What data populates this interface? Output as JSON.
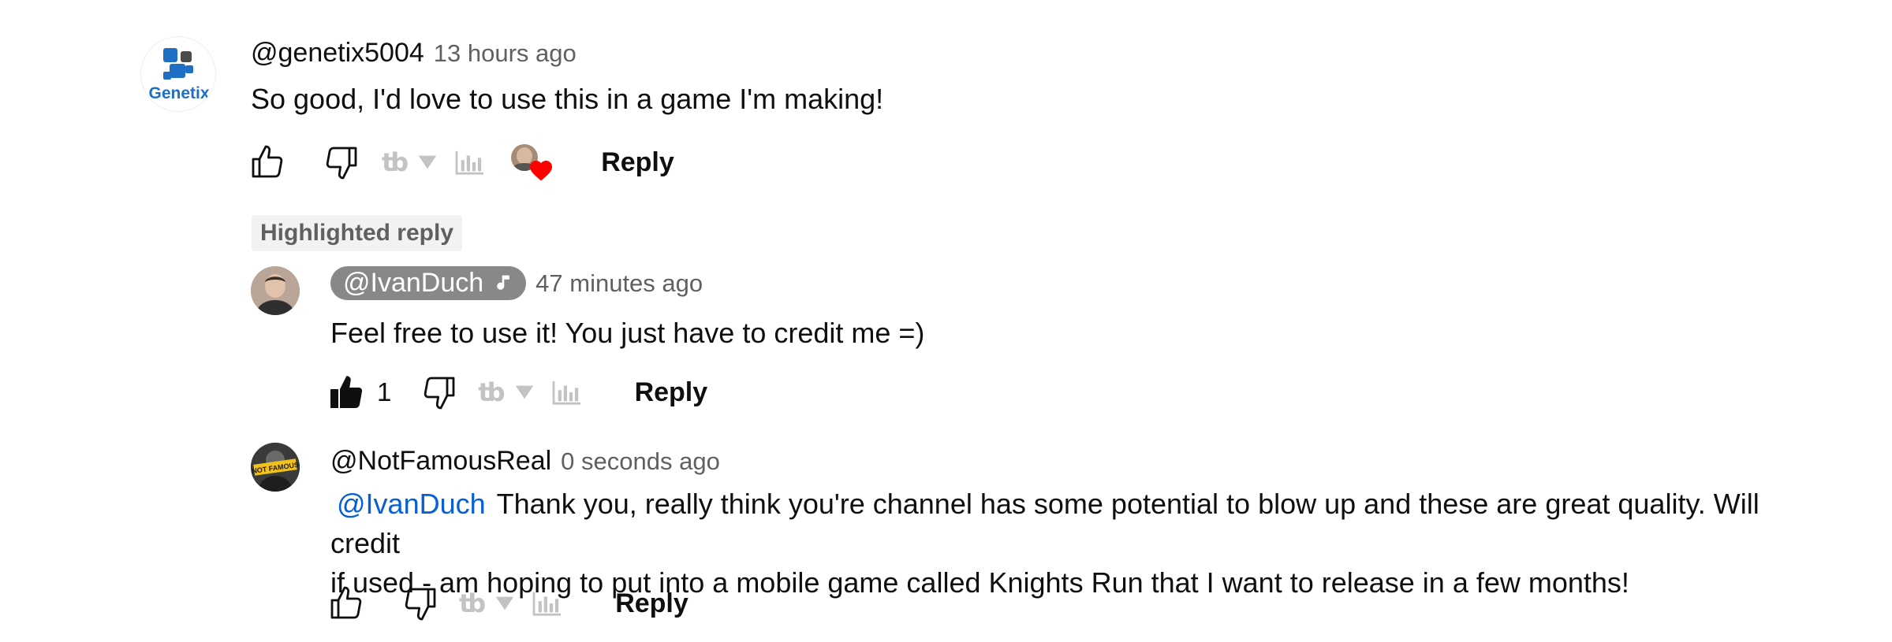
{
  "highlight_label": "Highlighted reply",
  "comments": [
    {
      "author": "@genetix5004",
      "time": "13 hours ago",
      "text": "So good, I'd love to use this in a game I'm making!",
      "avatar_label": "Genetix",
      "like_count": "",
      "reply_label": "Reply",
      "creator_heart": true
    },
    {
      "author": "@IvanDuch",
      "time": "47 minutes ago",
      "text": "Feel free to use it! You just have to credit me =)",
      "like_count": "1",
      "liked": true,
      "reply_label": "Reply",
      "is_creator": true
    },
    {
      "author": "@NotFamousReal",
      "time": "0 seconds ago",
      "mention": "@IvanDuch",
      "text_line1": "Thank you, really think you're channel has some potential to blow up and these are great quality. Will credit",
      "text_line2": "if used - am hoping to put into a mobile game called Knights Run that I want to release in a few months!",
      "avatar_label": "NOT FAMOUS",
      "reply_label": "Reply"
    }
  ],
  "extension": {
    "tb_label": "tb"
  },
  "colors": {
    "mention": "#065fd4",
    "heart": "#ff0000",
    "secondary_text": "#606060",
    "creator_pill": "#888888"
  }
}
